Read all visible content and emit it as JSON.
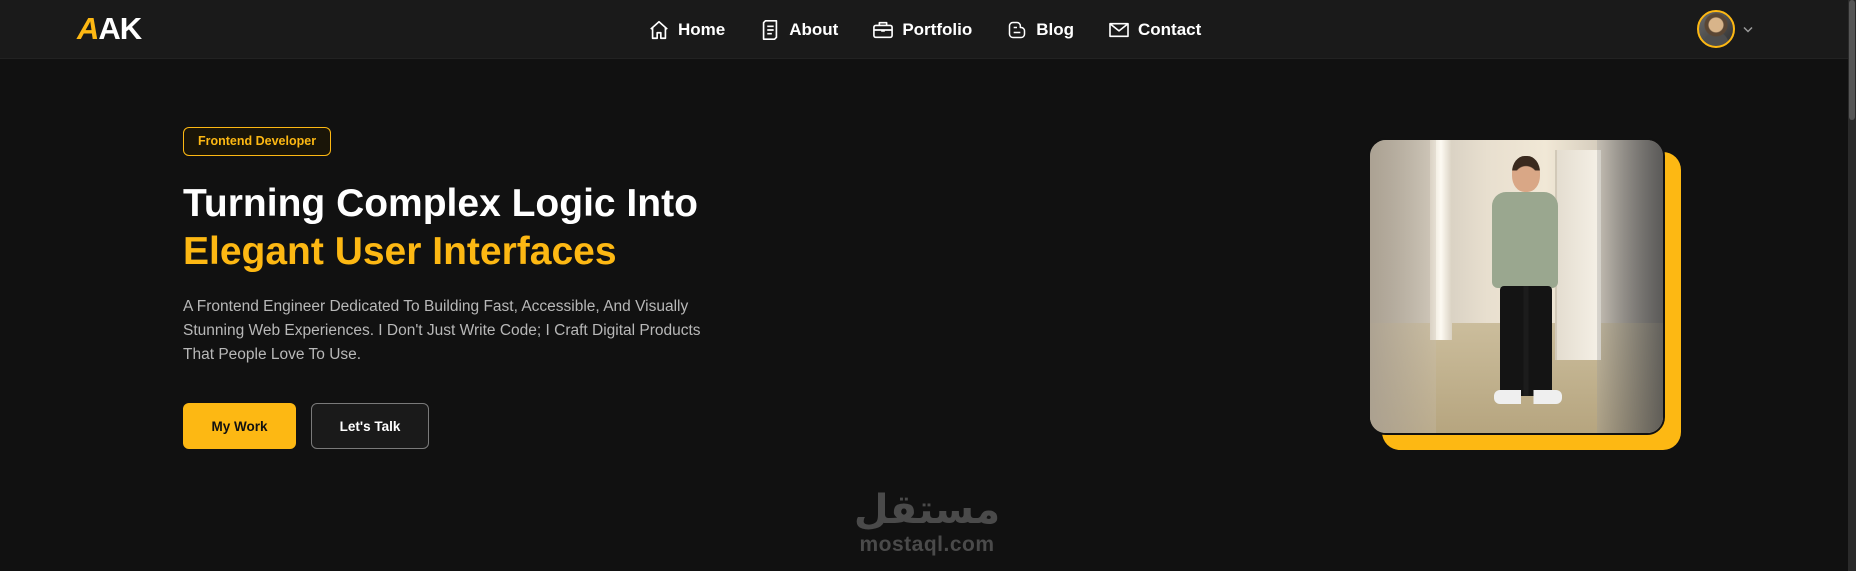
{
  "logo": {
    "accent": "A",
    "rest": "AK"
  },
  "nav": {
    "items": [
      {
        "label": "Home",
        "icon": "home-icon"
      },
      {
        "label": "About",
        "icon": "document-icon"
      },
      {
        "label": "Portfolio",
        "icon": "briefcase-icon"
      },
      {
        "label": "Blog",
        "icon": "blogger-icon"
      },
      {
        "label": "Contact",
        "icon": "mail-icon"
      }
    ]
  },
  "profile": {
    "icon": "chevron-down-icon"
  },
  "hero": {
    "badge": "Frontend Developer",
    "title_line1": "Turning Complex Logic Into",
    "title_line2": "Elegant User Interfaces",
    "description": "A Frontend Engineer Dedicated To Building Fast, Accessible, And Visually Stunning Web Experiences. I Don't Just Write Code; I Craft Digital Products That People Love To Use.",
    "primary_button": "My Work",
    "secondary_button": "Let's Talk"
  },
  "watermark": {
    "arabic": "مستقل",
    "latin": "mostaql.com"
  },
  "colors": {
    "accent": "#fdb813",
    "background": "#111111",
    "navbar": "#1a1a1a",
    "text": "#ffffff",
    "muted_text": "#b8b8b8"
  }
}
